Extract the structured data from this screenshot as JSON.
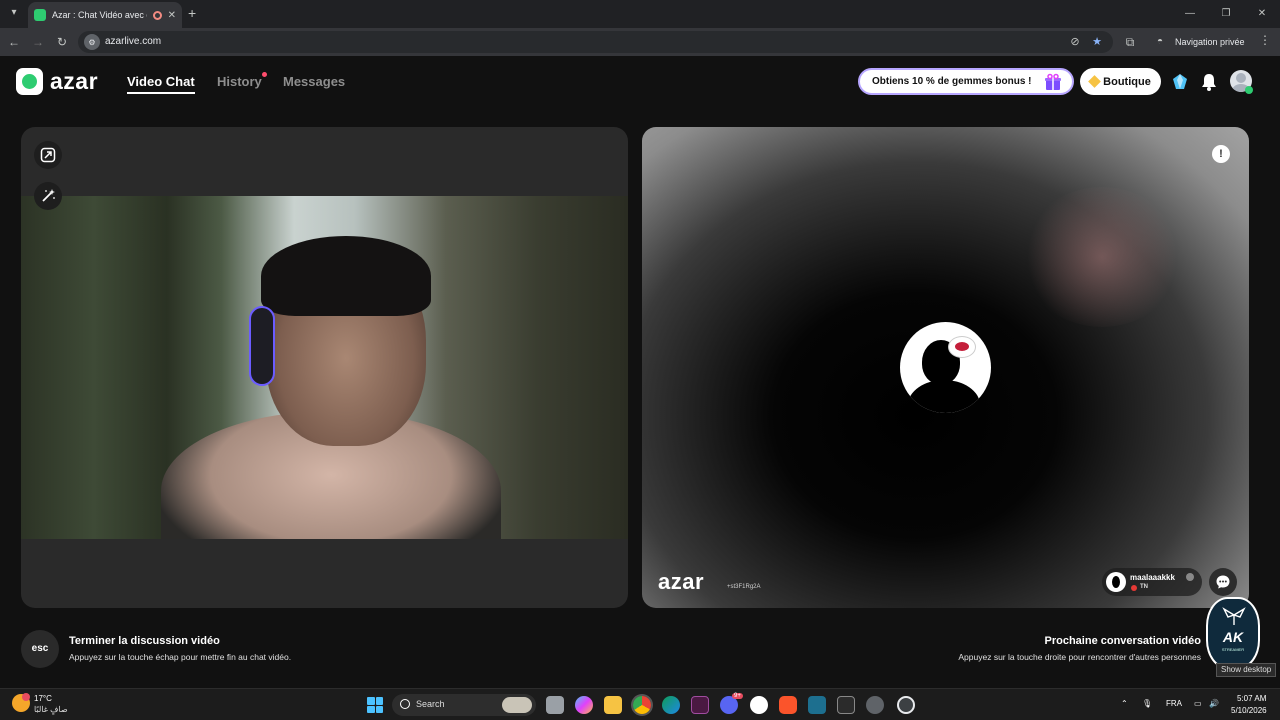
{
  "browser": {
    "tab_title": "Azar : Chat Vidéo avec de n",
    "url": "azarlive.com",
    "incognito_label": "Navigation privée"
  },
  "header": {
    "logo_text": "azar",
    "nav": [
      {
        "label": "Video Chat",
        "active": true
      },
      {
        "label": "History",
        "active": false,
        "has_notification": true
      },
      {
        "label": "Messages",
        "active": false
      }
    ],
    "promo_label": "Obtiens 10 % de gemmes bonus !",
    "shop_label": "Boutique"
  },
  "partner": {
    "watermark": "azar",
    "session_id": "+st3F1Rg2A",
    "username": "maalaaakkk",
    "country": "TN"
  },
  "hints": {
    "esc_key": "esc",
    "end_title": "Terminer la discussion vidéo",
    "end_sub": "Appuyez sur la touche échap pour mettre fin au chat vidéo.",
    "next_title": "Prochaine conversation vidéo",
    "next_sub": "Appuyez sur la touche droite pour rencontrer d'autres personnes"
  },
  "overlay": {
    "emblem_text": "AK",
    "emblem_small": "STREAMER",
    "tooltip": "Show desktop"
  },
  "taskbar": {
    "temperature": "17°C",
    "weather_desc": "صافٍ غالبًا",
    "search_placeholder": "Search",
    "language": "FRA",
    "time": "5:07 AM",
    "date": "5/10/2026",
    "discord_badge": "9+"
  },
  "colors": {
    "accent_green": "#2ecc71",
    "promo_border": "#b7a6ff",
    "gem_yellow": "#f6c343",
    "notification_red": "#ff4d6d"
  }
}
